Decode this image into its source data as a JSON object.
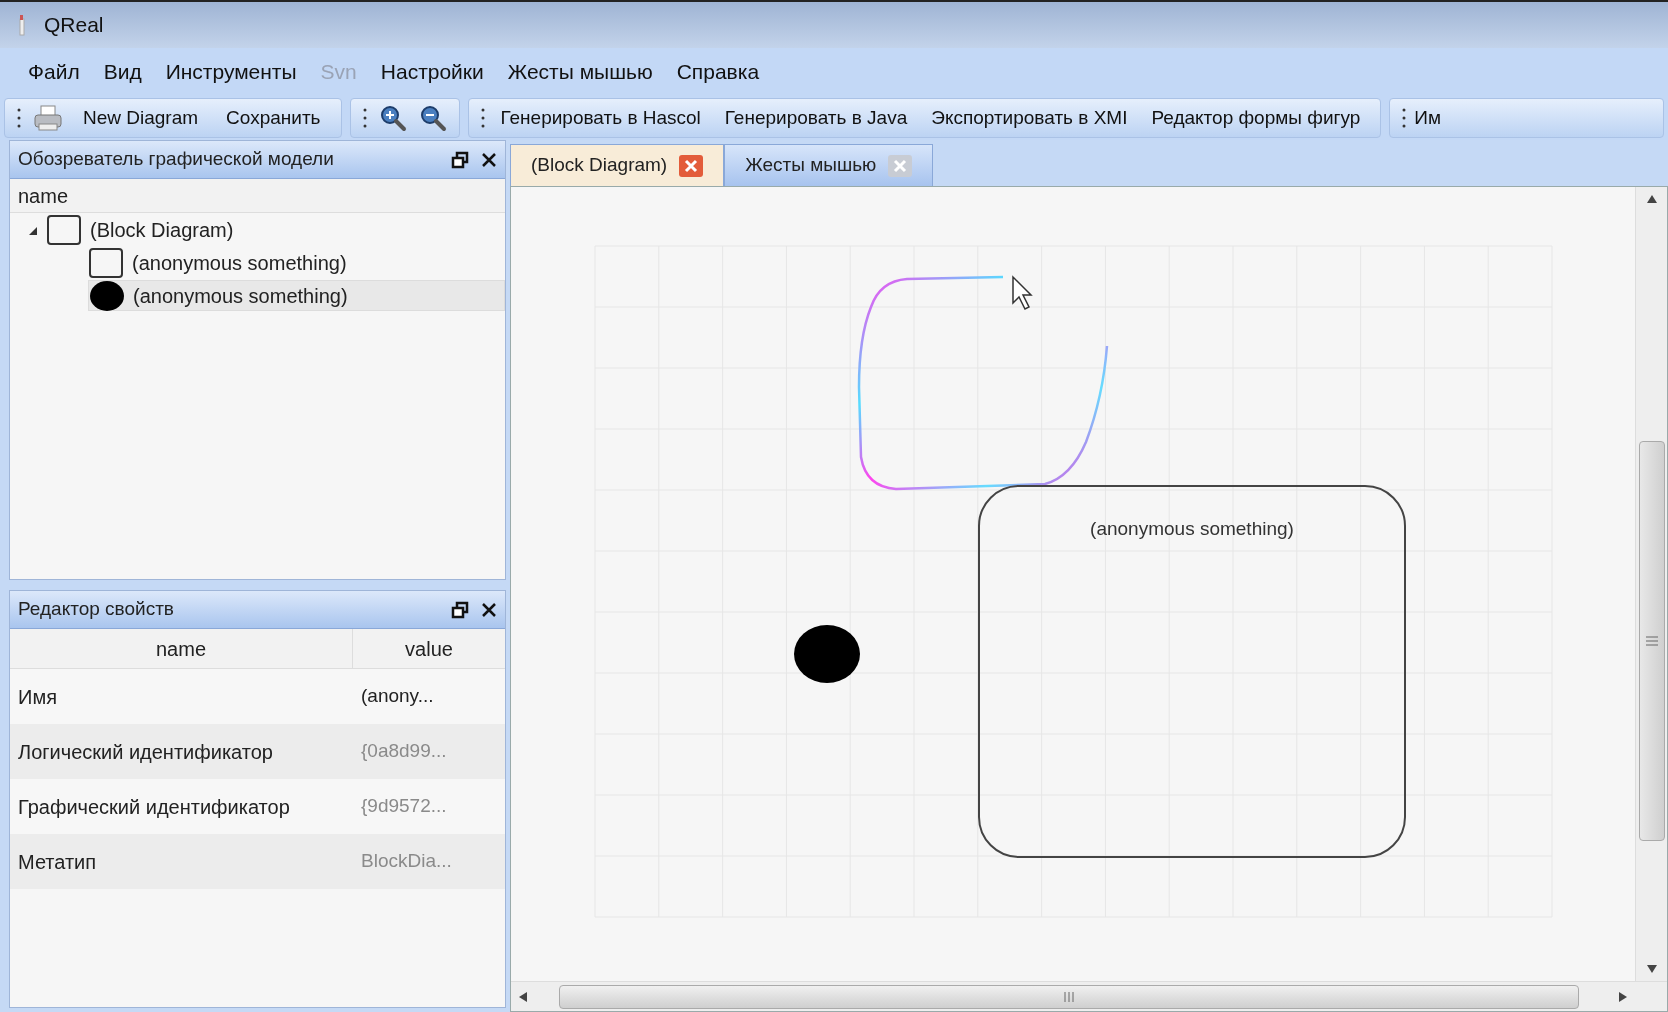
{
  "window": {
    "title": "QReal"
  },
  "menu": [
    {
      "label": "Файл",
      "disabled": false
    },
    {
      "label": "Вид",
      "disabled": false
    },
    {
      "label": "Инструменты",
      "disabled": false
    },
    {
      "label": "Svn",
      "disabled": true
    },
    {
      "label": "Настройки",
      "disabled": false
    },
    {
      "label": "Жесты мышью",
      "disabled": false
    },
    {
      "label": "Справка",
      "disabled": false
    }
  ],
  "toolbar": {
    "file_buttons": [
      "New Diagram",
      "Сохранить"
    ],
    "generate_buttons": [
      "Генерировать в Hascol",
      "Генерировать в Java",
      "Экспортировать в XMI",
      "Редактор формы фигур"
    ],
    "more_buttons": [
      "Им"
    ]
  },
  "explorer": {
    "title": "Обозреватель графической модели",
    "column": "name",
    "tree": [
      {
        "label": "(Block Diagram)",
        "kind": "square",
        "expanded": true,
        "selected": false,
        "children": [
          {
            "label": "(anonymous something)",
            "kind": "square",
            "selected": false
          },
          {
            "label": "(anonymous something)",
            "kind": "circle",
            "selected": true
          }
        ]
      }
    ]
  },
  "properties": {
    "title": "Редактор свойств",
    "columns": [
      "name",
      "value"
    ],
    "rows": [
      {
        "name": "Имя",
        "value": "(anony...",
        "disabled": false
      },
      {
        "name": "Логический идентификатор",
        "value": "{0a8d99...",
        "disabled": true
      },
      {
        "name": "Графический идентификатор",
        "value": "{9d9572...",
        "disabled": true
      },
      {
        "name": "Метатип",
        "value": "BlockDia...",
        "disabled": true
      }
    ]
  },
  "tabs": [
    {
      "label": "(Block Diagram)",
      "selected": true
    },
    {
      "label": "Жесты мышью",
      "selected": false
    }
  ],
  "canvas": {
    "nodes": [
      {
        "kind": "rounded-rect",
        "label": "(anonymous something)"
      },
      {
        "kind": "circle"
      }
    ]
  }
}
